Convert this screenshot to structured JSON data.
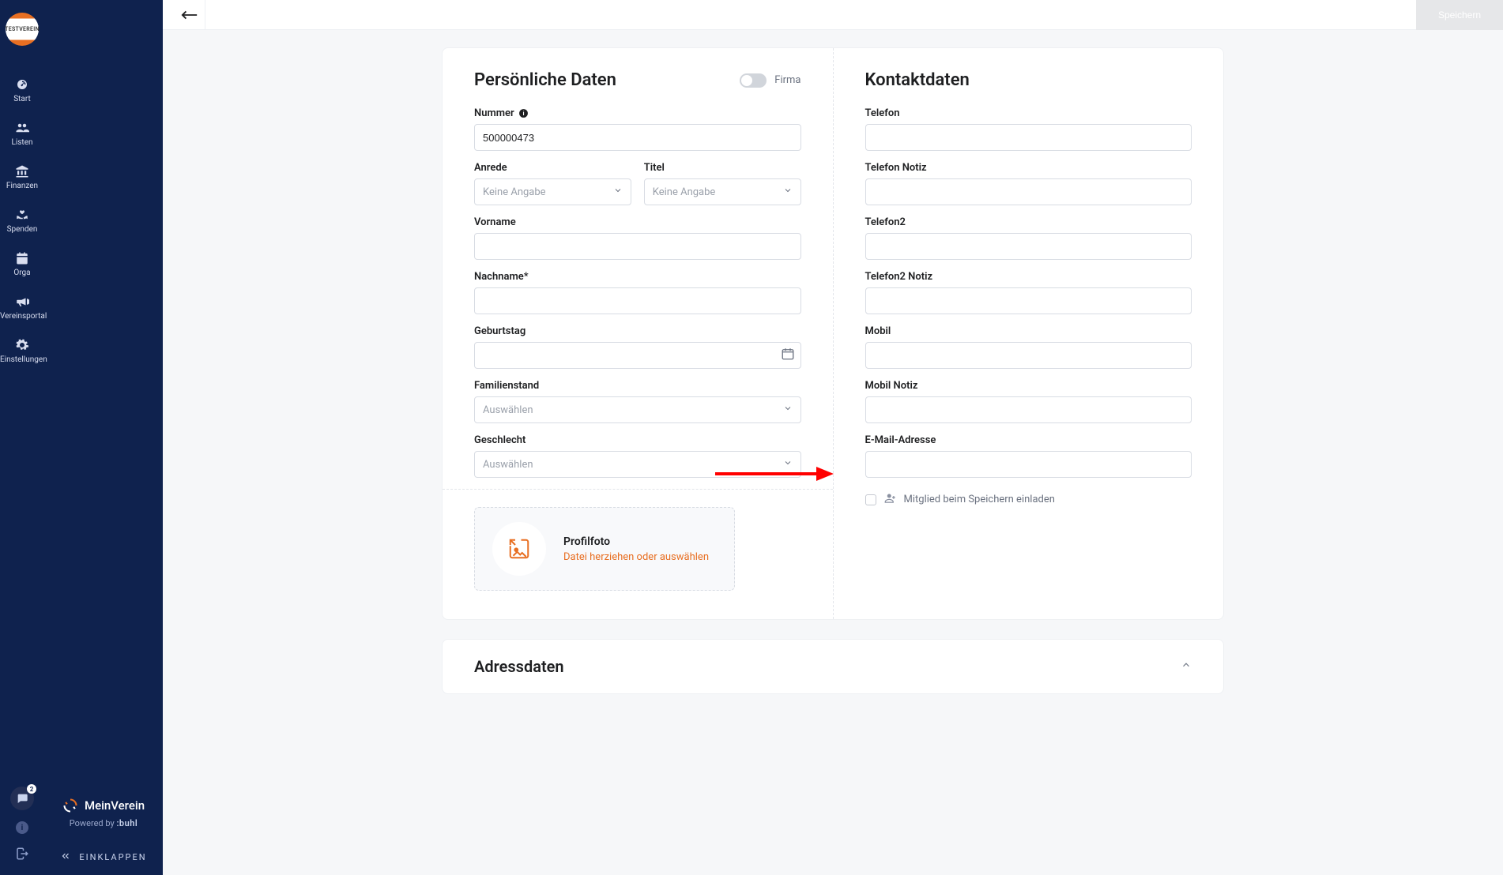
{
  "sidebar": {
    "logo_text": "TESTVEREIN",
    "items": [
      {
        "label": "Start"
      },
      {
        "label": "Listen"
      },
      {
        "label": "Finanzen"
      },
      {
        "label": "Spenden"
      },
      {
        "label": "Orga"
      },
      {
        "label": "Vereinsportal"
      },
      {
        "label": "Einstellungen"
      }
    ],
    "chat_count": "2",
    "brand": "MeinVerein",
    "powered_prefix": "Powered by",
    "powered_by": ":buhl",
    "collapse": "EINKLAPPEN"
  },
  "topbar": {
    "save": "Speichern"
  },
  "personal": {
    "heading": "Persönliche Daten",
    "firma_label": "Firma",
    "nummer_label": "Nummer",
    "nummer_value": "500000473",
    "anrede_label": "Anrede",
    "anrede_placeholder": "Keine Angabe",
    "titel_label": "Titel",
    "titel_placeholder": "Keine Angabe",
    "vorname_label": "Vorname",
    "nachname_label": "Nachname*",
    "geburtstag_label": "Geburtstag",
    "familienstand_label": "Familienstand",
    "familienstand_placeholder": "Auswählen",
    "geschlecht_label": "Geschlecht",
    "geschlecht_placeholder": "Auswählen"
  },
  "kontakt": {
    "heading": "Kontaktdaten",
    "telefon_label": "Telefon",
    "telefon_notiz_label": "Telefon Notiz",
    "telefon2_label": "Telefon2",
    "telefon2_notiz_label": "Telefon2 Notiz",
    "mobil_label": "Mobil",
    "mobil_notiz_label": "Mobil Notiz",
    "email_label": "E-Mail-Adresse",
    "invite_label": "Mitglied beim Speichern einladen"
  },
  "upload": {
    "title": "Profilfoto",
    "hint": "Datei herziehen oder auswählen"
  },
  "address": {
    "heading": "Adressdaten"
  }
}
